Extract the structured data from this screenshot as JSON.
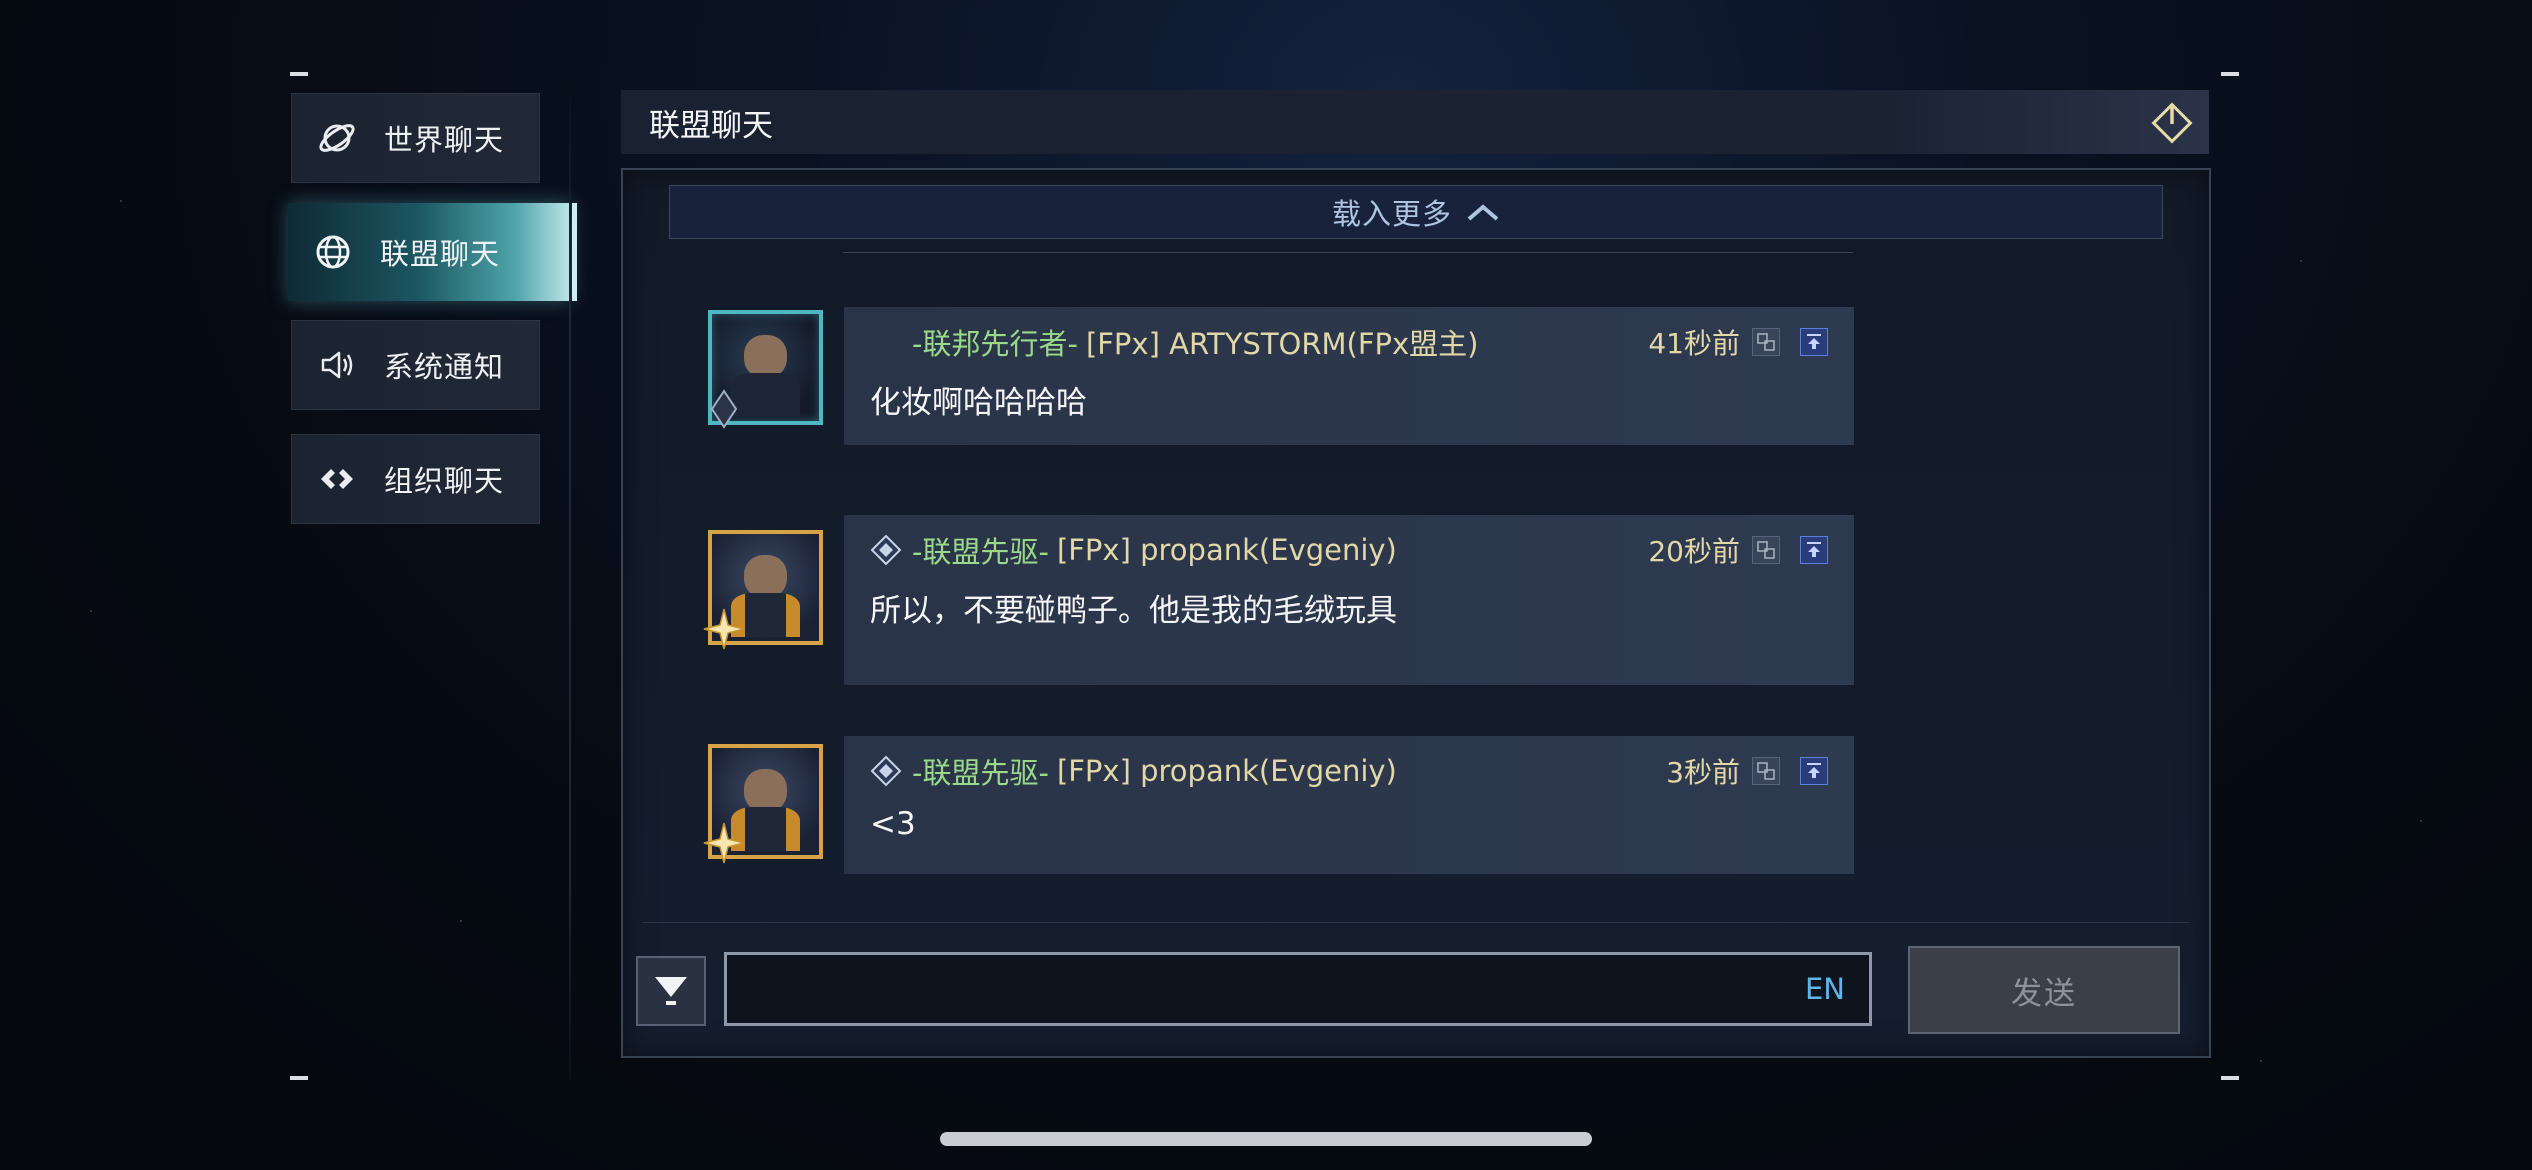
{
  "sidebar": {
    "items": [
      {
        "label": "世界聊天",
        "icon": "planet-icon",
        "active": false
      },
      {
        "label": "联盟聊天",
        "icon": "globe-icon",
        "active": true
      },
      {
        "label": "系统通知",
        "icon": "speaker-icon",
        "active": false
      },
      {
        "label": "组织聊天",
        "icon": "diamond-link-icon",
        "active": false
      }
    ]
  },
  "header": {
    "title": "联盟聊天",
    "power_icon": "power-icon"
  },
  "chat": {
    "load_more_label": "载入更多",
    "messages": [
      {
        "rank": "-联邦先行者-",
        "player": "[FPx] ARTYSTORM(FPx盟主)",
        "time": "41秒前",
        "text": "化妆啊哈哈哈哈",
        "avatar": "teal-frame-avatar",
        "rank_icon": null
      },
      {
        "rank": "-联盟先驱-",
        "player": "[FPx] propank(Evgeniy)",
        "time": "20秒前",
        "text": "所以，不要碰鸭子。他是我的毛绒玩具",
        "avatar": "gold-frame-avatar",
        "rank_icon": "rank-diamond-icon"
      },
      {
        "rank": "-联盟先驱-",
        "player": "[FPx] propank(Evgeniy)",
        "time": "3秒前",
        "text": "<3",
        "avatar": "gold-frame-avatar",
        "rank_icon": "rank-diamond-icon"
      }
    ]
  },
  "input": {
    "value": "",
    "lang_label": "EN",
    "send_label": "发送"
  },
  "colors": {
    "rank_green": "#9bd98a",
    "name_gold": "#e2d7a6",
    "active_tab": "#4ea3a9",
    "lang_blue": "#5fb6e6"
  }
}
